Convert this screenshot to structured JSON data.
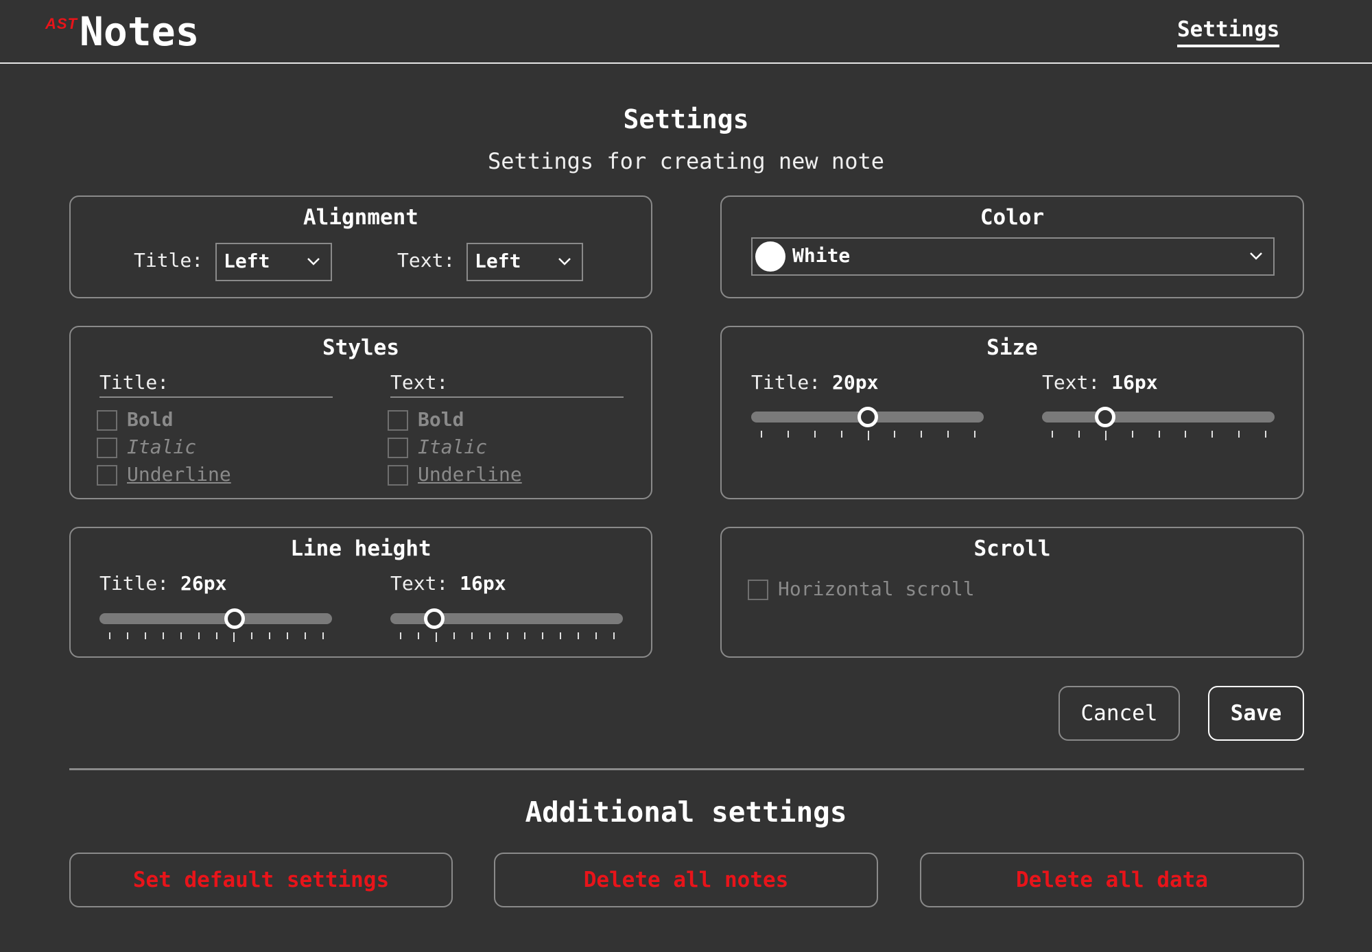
{
  "app": {
    "logo_sup": "AST",
    "logo_text": "Notes"
  },
  "nav": {
    "settings": "Settings"
  },
  "page": {
    "title": "Settings",
    "subtitle": "Settings for creating new note"
  },
  "alignment": {
    "title": "Alignment",
    "title_label": "Title:",
    "title_value": "Left",
    "text_label": "Text:",
    "text_value": "Left"
  },
  "color": {
    "title": "Color",
    "value": "White",
    "swatch": "#ffffff"
  },
  "styles": {
    "title": "Styles",
    "title_col": "Title:",
    "text_col": "Text:",
    "options": {
      "bold": "Bold",
      "italic": "Italic",
      "underline": "Underline"
    },
    "title_checked": {
      "bold": false,
      "italic": false,
      "underline": false
    },
    "text_checked": {
      "bold": false,
      "italic": false,
      "underline": false
    }
  },
  "size": {
    "title": "Size",
    "title_label": "Title:",
    "title_value": "20px",
    "title_fraction": 0.5,
    "text_label": "Text:",
    "text_value": "16px",
    "text_fraction": 0.27
  },
  "line_height": {
    "title": "Line height",
    "title_label": "Title:",
    "title_value": "26px",
    "title_fraction": 0.58,
    "text_label": "Text:",
    "text_value": "16px",
    "text_fraction": 0.19
  },
  "scroll": {
    "title": "Scroll",
    "horizontal": "Horizontal scroll",
    "horizontal_checked": false
  },
  "actions": {
    "cancel": "Cancel",
    "save": "Save"
  },
  "additional": {
    "title": "Additional settings",
    "set_default": "Set default settings",
    "delete_notes": "Delete all notes",
    "delete_data": "Delete all data"
  },
  "colors": {
    "background": "#333333",
    "danger": "#e8141a",
    "accent": "#ffffff"
  }
}
